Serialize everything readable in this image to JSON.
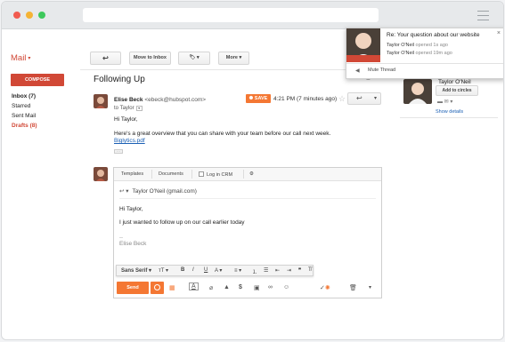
{
  "app": {
    "name": "Mail"
  },
  "sidebar": {
    "compose_label": "COMPOSE",
    "folders": [
      {
        "label": "Inbox (7)",
        "style": "bold"
      },
      {
        "label": "Starred",
        "style": "normal"
      },
      {
        "label": "Sent Mail",
        "style": "normal"
      },
      {
        "label": "Drafts (8)",
        "style": "red"
      }
    ]
  },
  "toolbar": {
    "move_to_inbox": "Move to Inbox",
    "more": "More"
  },
  "thread": {
    "subject": "Following Up",
    "sender_name": "Elise Beck",
    "sender_email": "<ebeck@hubspot.com>",
    "to_line": "to Taylor",
    "save_badge": "SAVE",
    "time": "4:21 PM (7 minutes ago)",
    "greeting": "Hi Taylor,",
    "body": "Here's a great overview that you can share with your team before our call next week.",
    "attachment": "Biglytics.pdf",
    "ellipsis": "…"
  },
  "reply": {
    "tabs": [
      "Templates",
      "Documents",
      "Log in CRM"
    ],
    "recipient": "Taylor O'Neil (gmail.com)",
    "greeting": "Hi Taylor,",
    "line": "I just wanted to follow up on our call earlier today",
    "dash": "--",
    "signature": "Elise Beck",
    "font": "Sans Serif",
    "send_label": "Send"
  },
  "notification": {
    "title": "Re: Your question about our website",
    "line1_name": "Taylor O'Neil",
    "line1_status": "opened 1s ago",
    "line2_name": "Taylor O'Neil",
    "line2_status": "opened 19m ago",
    "mute_label": "Mute Thread"
  },
  "contact": {
    "name": "Taylor O'Neil",
    "add_label": "Add to circles",
    "details_label": "Show details"
  },
  "colors": {
    "accent": "#d14836",
    "hubspot_orange": "#f47733",
    "link": "#1a5fb4"
  }
}
